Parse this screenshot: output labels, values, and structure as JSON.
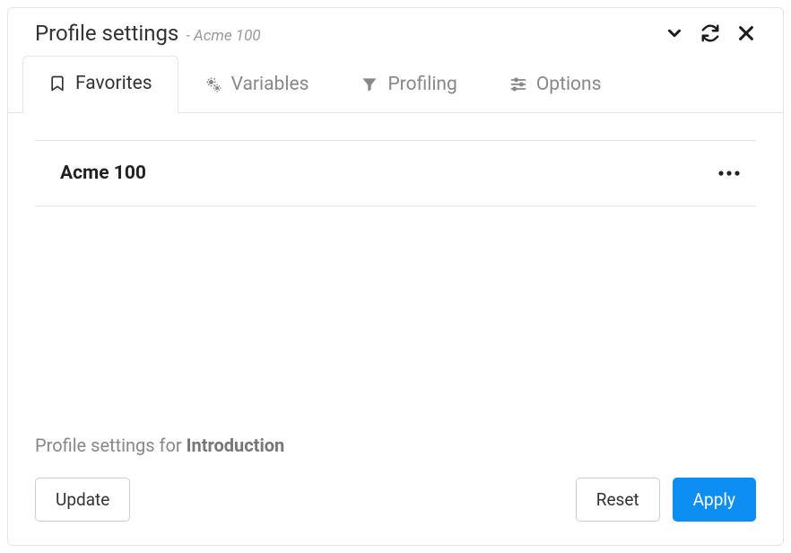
{
  "header": {
    "title": "Profile settings",
    "subtitle": "- Acme 100"
  },
  "tabs": {
    "favorites": "Favorites",
    "variables": "Variables",
    "profiling": "Profiling",
    "options": "Options"
  },
  "favorite": {
    "name": "Acme 100"
  },
  "caption": {
    "prefix": "Profile settings for ",
    "target": "Introduction"
  },
  "buttons": {
    "update": "Update",
    "reset": "Reset",
    "apply": "Apply"
  }
}
